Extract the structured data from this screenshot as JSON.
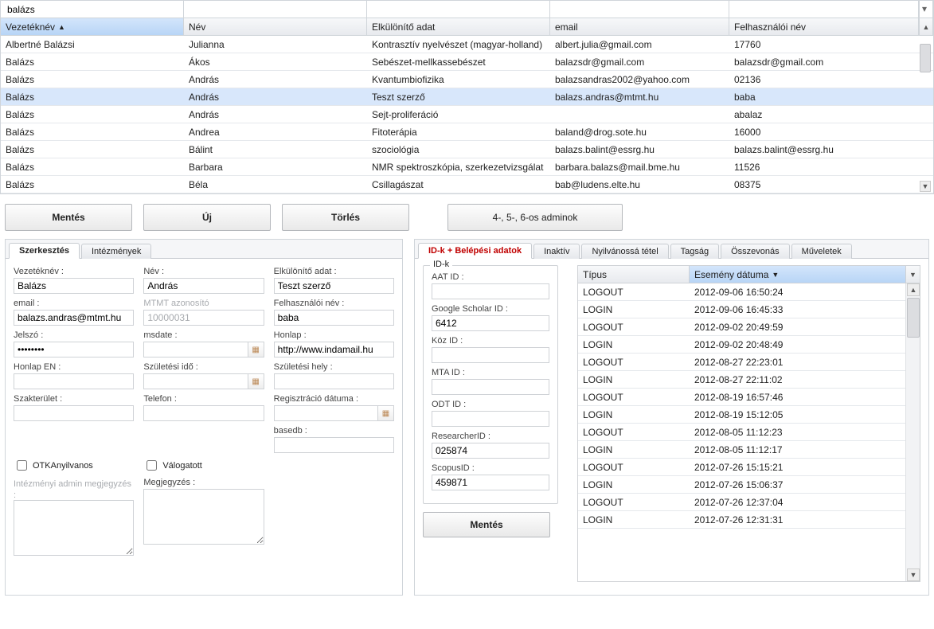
{
  "grid": {
    "filter_text": "balázs",
    "columns": [
      "Vezetéknév",
      "Név",
      "Elkülönítő adat",
      "email",
      "Felhasználói név"
    ],
    "sort_col": 0,
    "rows": [
      {
        "cells": [
          "Albertné Balázsi",
          "Julianna",
          "Kontrasztív nyelvészet (magyar-holland)",
          "albert.julia@gmail.com",
          "17760"
        ],
        "sel": false
      },
      {
        "cells": [
          "Balázs",
          "Ákos",
          "Sebészet-mellkassebészet",
          "balazsdr@gmail.com",
          "balazsdr@gmail.com"
        ],
        "sel": false
      },
      {
        "cells": [
          "Balázs",
          "András",
          "Kvantumbiofizika",
          "balazsandras2002@yahoo.com",
          "02136"
        ],
        "sel": false
      },
      {
        "cells": [
          "Balázs",
          "András",
          "Teszt szerző",
          "balazs.andras@mtmt.hu",
          "baba"
        ],
        "sel": true
      },
      {
        "cells": [
          "Balázs",
          "András",
          "Sejt-proliferáció",
          "",
          "abalaz"
        ],
        "sel": false
      },
      {
        "cells": [
          "Balázs",
          "Andrea",
          "Fitoterápia",
          "baland@drog.sote.hu",
          "16000"
        ],
        "sel": false
      },
      {
        "cells": [
          "Balázs",
          "Bálint",
          "szociológia",
          "balazs.balint@essrg.hu",
          "balazs.balint@essrg.hu"
        ],
        "sel": false
      },
      {
        "cells": [
          "Balázs",
          "Barbara",
          "NMR spektroszkópia, szerkezetvizsgálat",
          "barbara.balazs@mail.bme.hu",
          "11526"
        ],
        "sel": false
      },
      {
        "cells": [
          "Balázs",
          "Béla",
          "Csillagászat",
          "bab@ludens.elte.hu",
          "08375"
        ],
        "sel": false
      }
    ]
  },
  "buttons": {
    "save": "Mentés",
    "new": "Új",
    "delete": "Törlés",
    "admins": "4-, 5-, 6-os adminok"
  },
  "left_panel": {
    "tabs": [
      "Szerkesztés",
      "Intézmények"
    ],
    "form": {
      "vezeteknev_l": "Vezetéknév :",
      "vezeteknev": "Balázs",
      "nev_l": "Név :",
      "nev": "András",
      "elk_l": "Elkülönítő adat :",
      "elk": "Teszt szerző",
      "email_l": "email :",
      "email": "balazs.andras@mtmt.hu",
      "mtmt_l": "MTMT azonosító",
      "mtmt": "10000031",
      "user_l": "Felhasználói név :",
      "user": "baba",
      "pw_l": "Jelszó :",
      "pw": "••••••••",
      "msdate_l": "msdate :",
      "msdate": "",
      "honlap_l": "Honlap :",
      "honlap": "http://www.indamail.hu",
      "honlapen_l": "Honlap EN :",
      "honlapen": "",
      "szul_ido_l": "Születési idő :",
      "szul_ido": "",
      "szul_hely_l": "Születési hely :",
      "szul_hely": "",
      "szak_l": "Szakterület :",
      "szak": "",
      "tel_l": "Telefon :",
      "tel": "",
      "reg_l": "Regisztráció dátuma :",
      "reg": "",
      "basedb_l": "basedb :",
      "basedb": "",
      "otka_l": "OTKAnyilvanos",
      "valogatott_l": "Válogatott",
      "adminmegj_l": "Intézményi admin megjegyzés :",
      "megj_l": "Megjegyzés :"
    }
  },
  "right_panel": {
    "tabs": [
      "ID-k + Belépési adatok",
      "Inaktív",
      "Nyilvánossá tétel",
      "Tagság",
      "Összevonás",
      "Műveletek"
    ],
    "group_title": "ID-k",
    "ids": {
      "aat_l": "AAT ID :",
      "aat": "",
      "gsch_l": "Google Scholar ID :",
      "gsch": "6412",
      "koz_l": "Köz ID :",
      "koz": "",
      "mta_l": "MTA ID :",
      "mta": "",
      "odt_l": "ODT ID :",
      "odt": "",
      "res_l": "ResearcherID :",
      "res": "025874",
      "scop_l": "ScopusID :",
      "scop": "459871"
    },
    "save": "Mentés",
    "events": {
      "headers": [
        "Típus",
        "Esemény dátuma"
      ],
      "rows": [
        [
          "LOGOUT",
          "2012-09-06 16:50:24"
        ],
        [
          "LOGIN",
          "2012-09-06 16:45:33"
        ],
        [
          "LOGOUT",
          "2012-09-02 20:49:59"
        ],
        [
          "LOGIN",
          "2012-09-02 20:48:49"
        ],
        [
          "LOGOUT",
          "2012-08-27 22:23:01"
        ],
        [
          "LOGIN",
          "2012-08-27 22:11:02"
        ],
        [
          "LOGOUT",
          "2012-08-19 16:57:46"
        ],
        [
          "LOGIN",
          "2012-08-19 15:12:05"
        ],
        [
          "LOGOUT",
          "2012-08-05 11:12:23"
        ],
        [
          "LOGIN",
          "2012-08-05 11:12:17"
        ],
        [
          "LOGOUT",
          "2012-07-26 15:15:21"
        ],
        [
          "LOGIN",
          "2012-07-26 15:06:37"
        ],
        [
          "LOGOUT",
          "2012-07-26 12:37:04"
        ],
        [
          "LOGIN",
          "2012-07-26 12:31:31"
        ]
      ]
    }
  }
}
